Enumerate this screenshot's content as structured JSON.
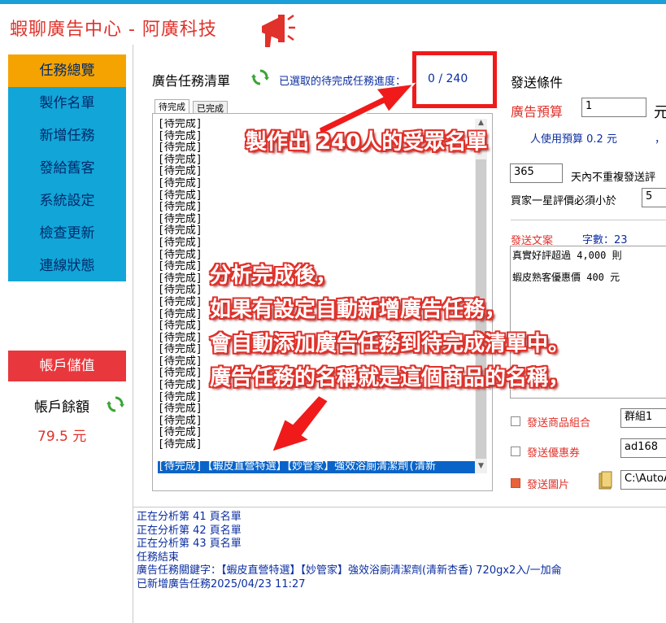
{
  "app": {
    "title": "蝦聊廣告中心 - 阿廣科技"
  },
  "sidebar": {
    "items": [
      {
        "label": "任務總覽"
      },
      {
        "label": "製作名單"
      },
      {
        "label": "新增任務"
      },
      {
        "label": "發給舊客"
      },
      {
        "label": "系統設定"
      },
      {
        "label": "檢查更新"
      },
      {
        "label": "連線狀態"
      }
    ],
    "recharge_label": "帳戶儲值",
    "balance_label": "帳戶餘額",
    "balance_value": "79.5 元"
  },
  "task_list": {
    "title": "廣告任務清單",
    "progress_label": "已選取的待完成任務進度：",
    "progress_value": "0 / 240",
    "tabs": [
      {
        "label": "待完成"
      },
      {
        "label": "已完成"
      }
    ],
    "rows": [
      "[待完成]",
      "[待完成]",
      "[待完成]",
      "[待完成]",
      "[待完成]",
      "[待完成]",
      "[待完成]",
      "[待完成]",
      "[待完成]",
      "[待完成]",
      "[待完成]",
      "[待完成]",
      "[待完成]",
      "[待完成]",
      "[待完成]",
      "[待完成]",
      "[待完成]",
      "[待完成]",
      "[待完成]",
      "[待完成]",
      "[待完成]",
      "[待完成]",
      "[待完成]",
      "[待完成]",
      "[待完成]",
      "[待完成]",
      "[待完成]",
      "[待完成]"
    ],
    "selected_row": "[待完成]【蝦皮直營特選】【妙管家】強效浴廁清潔劑(清新"
  },
  "conditions": {
    "title": "發送條件",
    "budget_label": "廣告預算",
    "budget_value": "1",
    "budget_unit": "元",
    "budget_note": "人使用預算 0.2 元",
    "budget_note_tail": "，",
    "days_value": "365",
    "days_label": "天內不重複發送評",
    "rating_label": "買家一星評價必須小於",
    "rating_value": "5",
    "copy_label": "發送文案",
    "count_label": "字數：23",
    "copy_lines": [
      "真實好評超過 4,000 則",
      "蝦皮熟客優惠價 400 元"
    ],
    "options": [
      {
        "label": "發送商品組合",
        "value": "群組1",
        "checked": false
      },
      {
        "label": "發送優惠券",
        "value": "ad168",
        "checked": false
      },
      {
        "label": "發送圖片",
        "value": "C:\\AutoA",
        "checked": true
      }
    ]
  },
  "log": {
    "lines": [
      "正在分析第 41 頁名單",
      "正在分析第 42 頁名單",
      "正在分析第 43 頁名單",
      "任務結束",
      "廣告任務關鍵字：【蝦皮直營特選】【妙管家】強效浴廁清潔劑(清新杏香) 720gx2入/一加侖",
      "已新增廣告任務2025/04/23 11:27"
    ]
  },
  "annotations": {
    "top": "製作出 240人的受眾名單",
    "middle": [
      "分析完成後，",
      "如果有設定自動新增廣告任務，",
      "會自動添加廣告任務到待完成清單中。",
      "廣告任務的名稱就是這個商品的名稱，"
    ]
  },
  "colors": {
    "accent_red": "#e0312a",
    "nav_blue": "#12a5d8",
    "nav_active": "#f5a300",
    "link_blue": "#0b2ea0"
  }
}
